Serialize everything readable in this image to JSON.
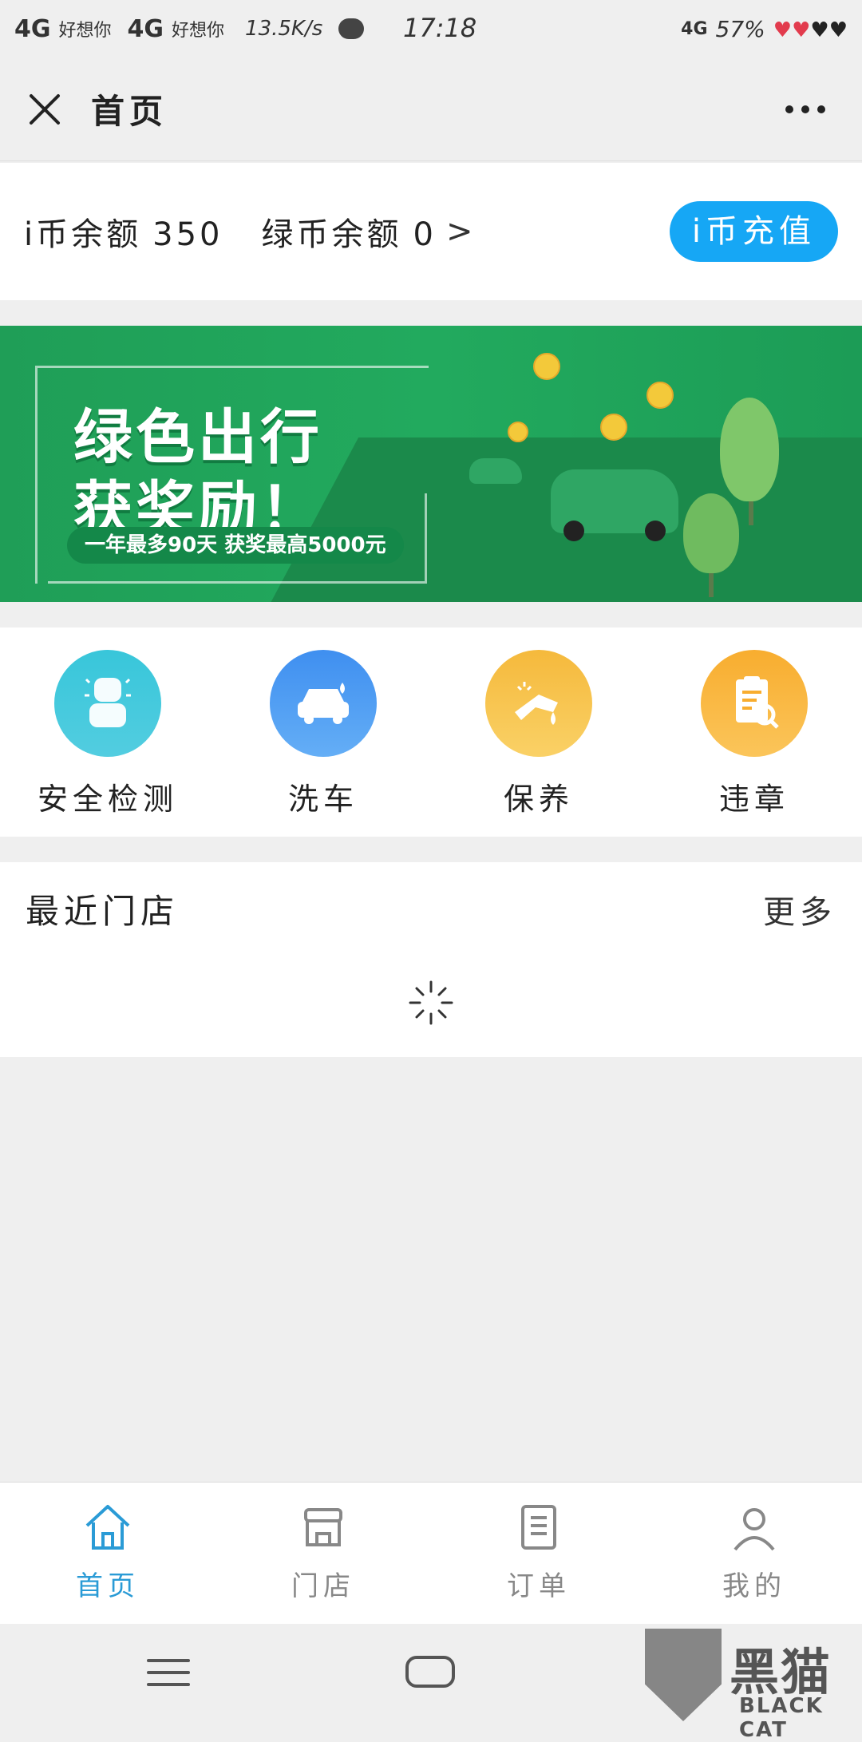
{
  "status_bar": {
    "net1": "4G",
    "carrier1": "好想你",
    "net2": "4G",
    "carrier2": "好想你",
    "speed": "13.5K/s",
    "time": "17:18",
    "signal": "4G",
    "battery": "57%",
    "icons": [
      "chat-bubble-icon",
      "heart-icon"
    ]
  },
  "header": {
    "title": "首页",
    "close_icon": "close-icon",
    "more_icon": "more-dots-icon"
  },
  "balance": {
    "i_coin_label": "i币余额",
    "i_coin_value": "350",
    "green_coin_label": "绿币余额",
    "green_coin_value": "0",
    "arrow": ">",
    "recharge_button": "i币充值"
  },
  "banner": {
    "headline1": "绿色出行",
    "headline2": "获奖励！",
    "subline": "一年最多90天 获奖最高5000元"
  },
  "services": [
    {
      "label": "安全检测",
      "icon": "car-seat-icon",
      "color": "#3fc4d8"
    },
    {
      "label": "洗车",
      "icon": "car-wash-icon",
      "color": "#4a9cf0"
    },
    {
      "label": "保养",
      "icon": "oil-maintenance-icon",
      "color": "#f7c146"
    },
    {
      "label": "违章",
      "icon": "violation-search-icon",
      "color": "#f9b63c"
    }
  ],
  "stores": {
    "title": "最近门店",
    "more": "更多"
  },
  "tabbar": {
    "items": [
      {
        "label": "首页",
        "icon": "home-icon",
        "active": true
      },
      {
        "label": "门店",
        "icon": "store-icon",
        "active": false
      },
      {
        "label": "订单",
        "icon": "order-icon",
        "active": false
      },
      {
        "label": "我的",
        "icon": "profile-icon",
        "active": false
      }
    ]
  },
  "watermark": {
    "cn": "黑猫",
    "en": "BLACK CAT"
  },
  "colors": {
    "accent": "#16a7f5",
    "tab_active": "#2a9bd6",
    "banner_green": "#22aa5e"
  }
}
